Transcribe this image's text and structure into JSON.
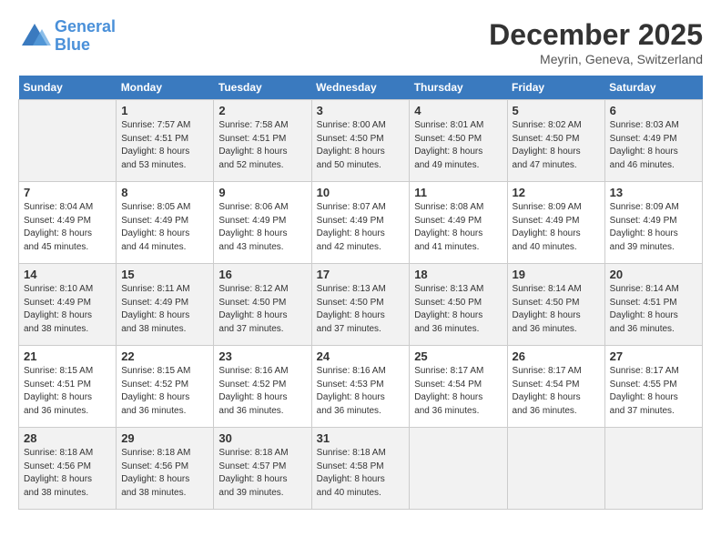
{
  "logo": {
    "line1": "General",
    "line2": "Blue"
  },
  "title": "December 2025",
  "location": "Meyrin, Geneva, Switzerland",
  "header": {
    "days": [
      "Sunday",
      "Monday",
      "Tuesday",
      "Wednesday",
      "Thursday",
      "Friday",
      "Saturday"
    ]
  },
  "weeks": [
    [
      {
        "day": "",
        "info": ""
      },
      {
        "day": "1",
        "info": "Sunrise: 7:57 AM\nSunset: 4:51 PM\nDaylight: 8 hours\nand 53 minutes."
      },
      {
        "day": "2",
        "info": "Sunrise: 7:58 AM\nSunset: 4:51 PM\nDaylight: 8 hours\nand 52 minutes."
      },
      {
        "day": "3",
        "info": "Sunrise: 8:00 AM\nSunset: 4:50 PM\nDaylight: 8 hours\nand 50 minutes."
      },
      {
        "day": "4",
        "info": "Sunrise: 8:01 AM\nSunset: 4:50 PM\nDaylight: 8 hours\nand 49 minutes."
      },
      {
        "day": "5",
        "info": "Sunrise: 8:02 AM\nSunset: 4:50 PM\nDaylight: 8 hours\nand 47 minutes."
      },
      {
        "day": "6",
        "info": "Sunrise: 8:03 AM\nSunset: 4:49 PM\nDaylight: 8 hours\nand 46 minutes."
      }
    ],
    [
      {
        "day": "7",
        "info": "Sunrise: 8:04 AM\nSunset: 4:49 PM\nDaylight: 8 hours\nand 45 minutes."
      },
      {
        "day": "8",
        "info": "Sunrise: 8:05 AM\nSunset: 4:49 PM\nDaylight: 8 hours\nand 44 minutes."
      },
      {
        "day": "9",
        "info": "Sunrise: 8:06 AM\nSunset: 4:49 PM\nDaylight: 8 hours\nand 43 minutes."
      },
      {
        "day": "10",
        "info": "Sunrise: 8:07 AM\nSunset: 4:49 PM\nDaylight: 8 hours\nand 42 minutes."
      },
      {
        "day": "11",
        "info": "Sunrise: 8:08 AM\nSunset: 4:49 PM\nDaylight: 8 hours\nand 41 minutes."
      },
      {
        "day": "12",
        "info": "Sunrise: 8:09 AM\nSunset: 4:49 PM\nDaylight: 8 hours\nand 40 minutes."
      },
      {
        "day": "13",
        "info": "Sunrise: 8:09 AM\nSunset: 4:49 PM\nDaylight: 8 hours\nand 39 minutes."
      }
    ],
    [
      {
        "day": "14",
        "info": "Sunrise: 8:10 AM\nSunset: 4:49 PM\nDaylight: 8 hours\nand 38 minutes."
      },
      {
        "day": "15",
        "info": "Sunrise: 8:11 AM\nSunset: 4:49 PM\nDaylight: 8 hours\nand 38 minutes."
      },
      {
        "day": "16",
        "info": "Sunrise: 8:12 AM\nSunset: 4:50 PM\nDaylight: 8 hours\nand 37 minutes."
      },
      {
        "day": "17",
        "info": "Sunrise: 8:13 AM\nSunset: 4:50 PM\nDaylight: 8 hours\nand 37 minutes."
      },
      {
        "day": "18",
        "info": "Sunrise: 8:13 AM\nSunset: 4:50 PM\nDaylight: 8 hours\nand 36 minutes."
      },
      {
        "day": "19",
        "info": "Sunrise: 8:14 AM\nSunset: 4:50 PM\nDaylight: 8 hours\nand 36 minutes."
      },
      {
        "day": "20",
        "info": "Sunrise: 8:14 AM\nSunset: 4:51 PM\nDaylight: 8 hours\nand 36 minutes."
      }
    ],
    [
      {
        "day": "21",
        "info": "Sunrise: 8:15 AM\nSunset: 4:51 PM\nDaylight: 8 hours\nand 36 minutes."
      },
      {
        "day": "22",
        "info": "Sunrise: 8:15 AM\nSunset: 4:52 PM\nDaylight: 8 hours\nand 36 minutes."
      },
      {
        "day": "23",
        "info": "Sunrise: 8:16 AM\nSunset: 4:52 PM\nDaylight: 8 hours\nand 36 minutes."
      },
      {
        "day": "24",
        "info": "Sunrise: 8:16 AM\nSunset: 4:53 PM\nDaylight: 8 hours\nand 36 minutes."
      },
      {
        "day": "25",
        "info": "Sunrise: 8:17 AM\nSunset: 4:54 PM\nDaylight: 8 hours\nand 36 minutes."
      },
      {
        "day": "26",
        "info": "Sunrise: 8:17 AM\nSunset: 4:54 PM\nDaylight: 8 hours\nand 36 minutes."
      },
      {
        "day": "27",
        "info": "Sunrise: 8:17 AM\nSunset: 4:55 PM\nDaylight: 8 hours\nand 37 minutes."
      }
    ],
    [
      {
        "day": "28",
        "info": "Sunrise: 8:18 AM\nSunset: 4:56 PM\nDaylight: 8 hours\nand 38 minutes."
      },
      {
        "day": "29",
        "info": "Sunrise: 8:18 AM\nSunset: 4:56 PM\nDaylight: 8 hours\nand 38 minutes."
      },
      {
        "day": "30",
        "info": "Sunrise: 8:18 AM\nSunset: 4:57 PM\nDaylight: 8 hours\nand 39 minutes."
      },
      {
        "day": "31",
        "info": "Sunrise: 8:18 AM\nSunset: 4:58 PM\nDaylight: 8 hours\nand 40 minutes."
      },
      {
        "day": "",
        "info": ""
      },
      {
        "day": "",
        "info": ""
      },
      {
        "day": "",
        "info": ""
      }
    ]
  ]
}
